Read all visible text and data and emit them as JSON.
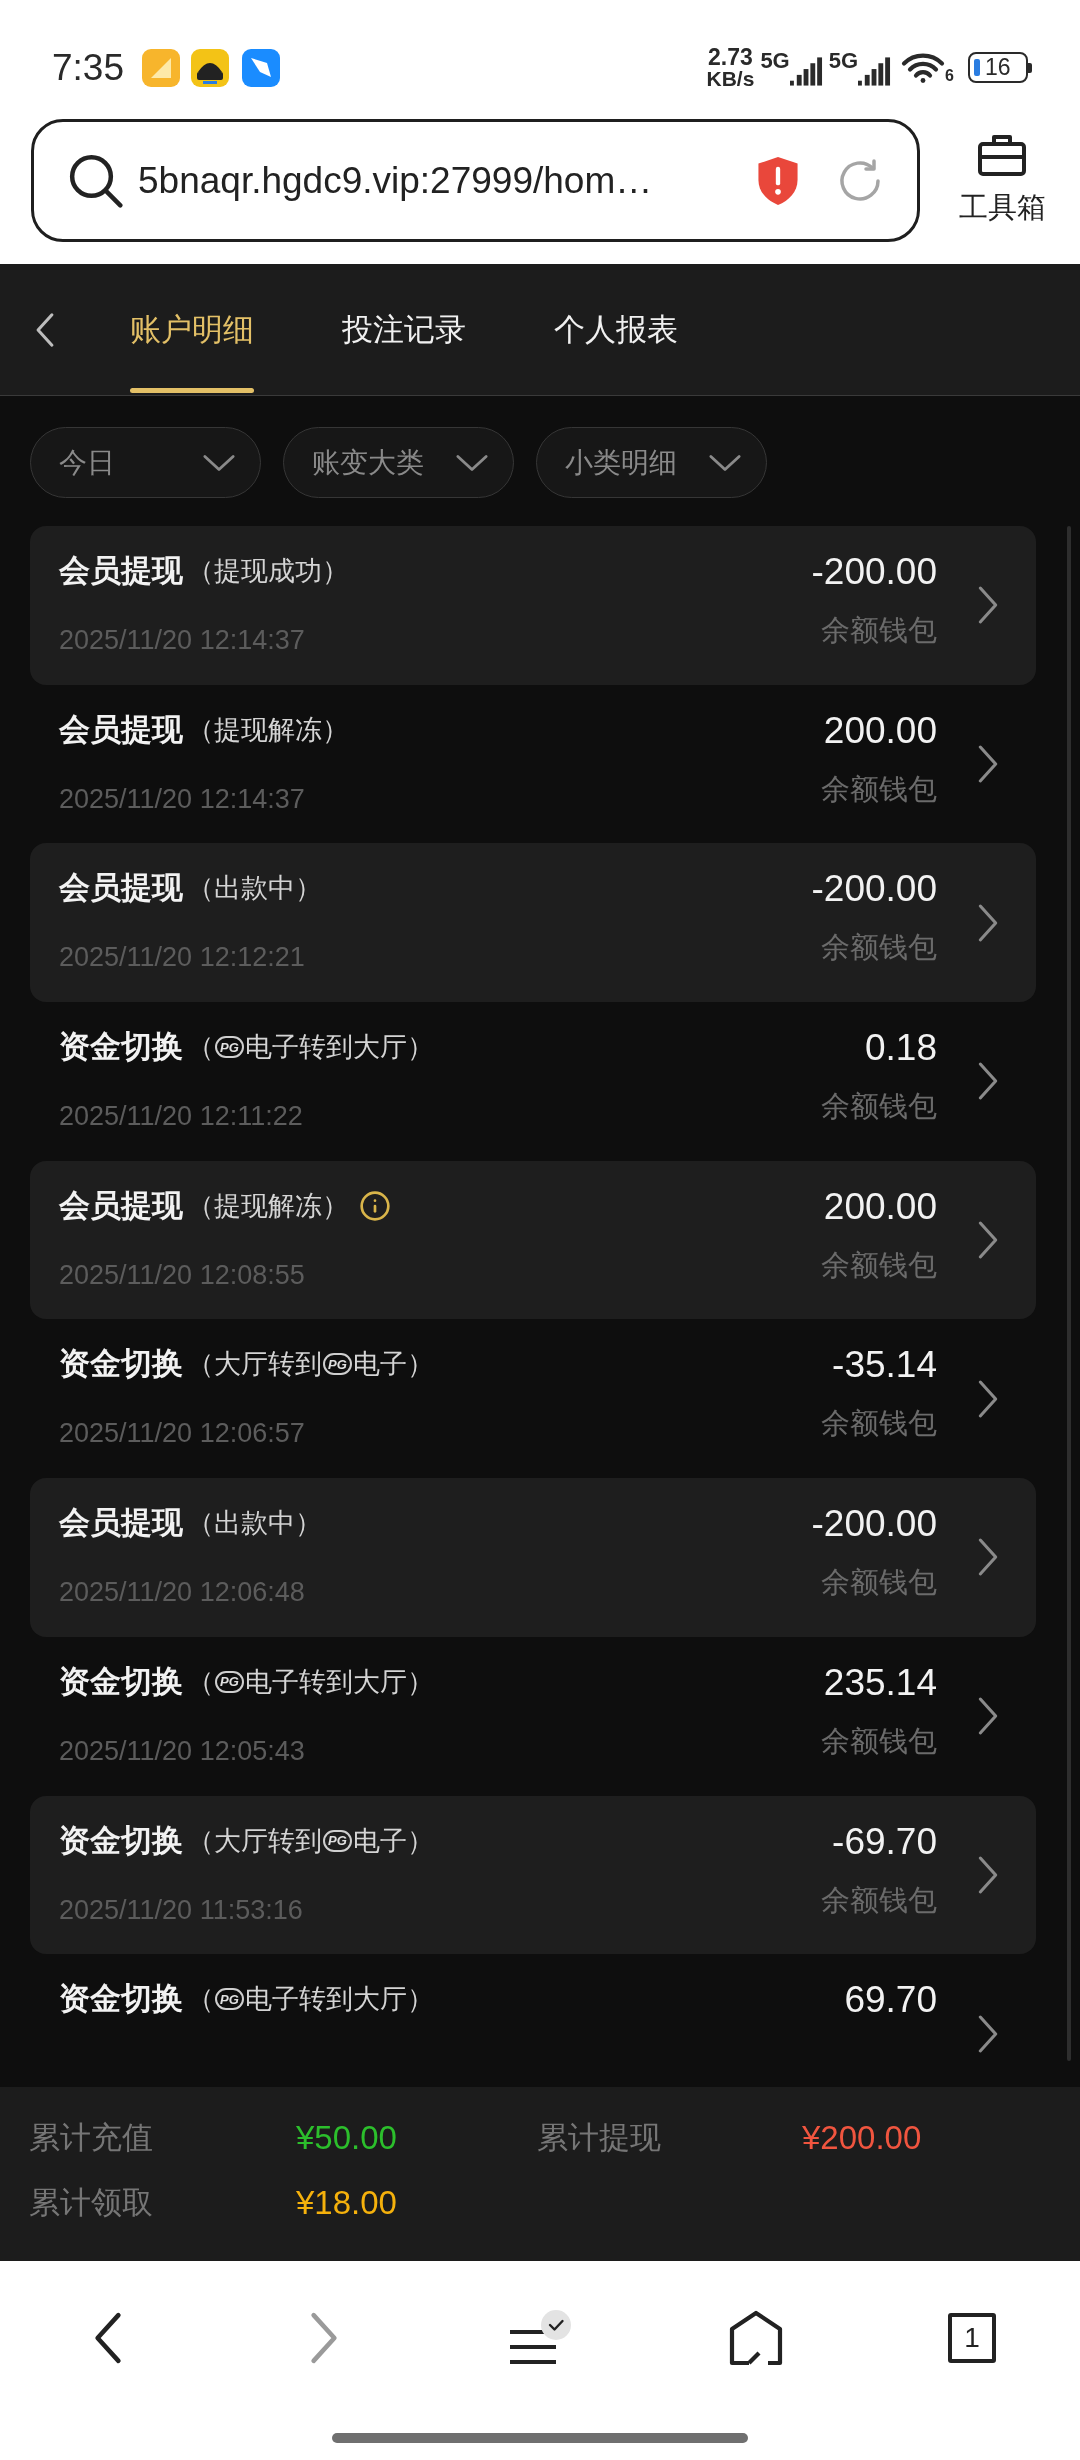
{
  "status_bar": {
    "time": "7:35",
    "speed": "2.73",
    "speed_unit": "KB/s",
    "networks": [
      "5G",
      "5G"
    ],
    "wifi_badge": "6",
    "battery": "16"
  },
  "browser": {
    "url": "5bnaqr.hgdc9.vip:27999/hom…",
    "tools_label": "工具箱"
  },
  "tabs": [
    {
      "label": "账户明细",
      "selected": true
    },
    {
      "label": "投注记录",
      "selected": false
    },
    {
      "label": "个人报表",
      "selected": false
    }
  ],
  "filters": [
    {
      "label": "今日"
    },
    {
      "label": "账变大类"
    },
    {
      "label": "小类明细"
    }
  ],
  "records": [
    {
      "title": "会员提现",
      "detail": [
        {
          "kind": "text",
          "text": "（提现成功）"
        }
      ],
      "info": false,
      "amount": "-200.00",
      "wallet": "余额钱包",
      "time": "2025/11/20 12:14:37"
    },
    {
      "title": "会员提现",
      "detail": [
        {
          "kind": "text",
          "text": "（提现解冻）"
        }
      ],
      "info": false,
      "amount": "200.00",
      "wallet": "余额钱包",
      "time": "2025/11/20 12:14:37"
    },
    {
      "title": "会员提现",
      "detail": [
        {
          "kind": "text",
          "text": "（出款中）"
        }
      ],
      "info": false,
      "amount": "-200.00",
      "wallet": "余额钱包",
      "time": "2025/11/20 12:12:21"
    },
    {
      "title": "资金切换",
      "detail": [
        {
          "kind": "text",
          "text": "（"
        },
        {
          "kind": "logo",
          "text": "PG"
        },
        {
          "kind": "text",
          "text": "电子转到大厅）"
        }
      ],
      "info": false,
      "amount": "0.18",
      "wallet": "余额钱包",
      "time": "2025/11/20 12:11:22"
    },
    {
      "title": "会员提现",
      "detail": [
        {
          "kind": "text",
          "text": "（提现解冻）"
        }
      ],
      "info": true,
      "amount": "200.00",
      "wallet": "余额钱包",
      "time": "2025/11/20 12:08:55"
    },
    {
      "title": "资金切换",
      "detail": [
        {
          "kind": "text",
          "text": "（大厅转到"
        },
        {
          "kind": "logo",
          "text": "PG"
        },
        {
          "kind": "text",
          "text": "电子）"
        }
      ],
      "info": false,
      "amount": "-35.14",
      "wallet": "余额钱包",
      "time": "2025/11/20 12:06:57"
    },
    {
      "title": "会员提现",
      "detail": [
        {
          "kind": "text",
          "text": "（出款中）"
        }
      ],
      "info": false,
      "amount": "-200.00",
      "wallet": "余额钱包",
      "time": "2025/11/20 12:06:48"
    },
    {
      "title": "资金切换",
      "detail": [
        {
          "kind": "text",
          "text": "（"
        },
        {
          "kind": "logo",
          "text": "PG"
        },
        {
          "kind": "text",
          "text": "电子转到大厅）"
        }
      ],
      "info": false,
      "amount": "235.14",
      "wallet": "余额钱包",
      "time": "2025/11/20 12:05:43"
    },
    {
      "title": "资金切换",
      "detail": [
        {
          "kind": "text",
          "text": "（大厅转到"
        },
        {
          "kind": "logo",
          "text": "PG"
        },
        {
          "kind": "text",
          "text": "电子）"
        }
      ],
      "info": false,
      "amount": "-69.70",
      "wallet": "余额钱包",
      "time": "2025/11/20 11:53:16"
    },
    {
      "title": "资金切换",
      "detail": [
        {
          "kind": "text",
          "text": "（"
        },
        {
          "kind": "logo",
          "text": "PG"
        },
        {
          "kind": "text",
          "text": "电子转到大厅）"
        }
      ],
      "info": false,
      "amount": "69.70"
    }
  ],
  "summary": [
    {
      "label": "累计充值",
      "value": "¥50.00",
      "color": "#2cbf2c"
    },
    {
      "label": "累计提现",
      "value": "¥200.00",
      "color": "#f0553f"
    },
    {
      "label": "累计领取",
      "value": "¥18.00",
      "color": "#f5b10c"
    }
  ],
  "nav": [
    {
      "kind": "back",
      "disabled": false
    },
    {
      "kind": "forward",
      "disabled": true
    },
    {
      "kind": "menu",
      "disabled": false
    },
    {
      "kind": "home",
      "disabled": false
    },
    {
      "kind": "tabs",
      "disabled": false,
      "label": "1"
    }
  ]
}
